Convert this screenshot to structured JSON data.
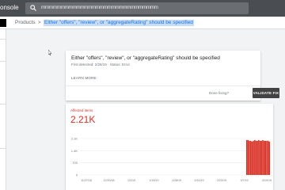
{
  "header": {
    "app_title": "onsole",
    "search": {
      "icon": "search-icon",
      "value": "Inspect any URL in \"m\"",
      "value_prefix": "",
      "value_masked": "mmmmmmmmmmmmmmmmmmmmmmmmmmmmmm"
    }
  },
  "breadcrumb": {
    "items": [
      {
        "label": "Products"
      },
      {
        "label": ">"
      },
      {
        "label": "Either \"offers\", \"review\", or \"aggregateRating\" should be specified"
      }
    ]
  },
  "issue": {
    "title": "Either \"offers\", \"review\", or \"aggregateRating\" should be specified",
    "meta": "First detected: 2/28/19  ·  Status: Error",
    "learn_more": "LEARN MORE",
    "done_fixing": "Done fixing?",
    "validate_button": "VALIDATE FIX"
  },
  "affected": {
    "label": "Affected items",
    "value": "2.21K"
  },
  "chart_data": {
    "type": "bar",
    "series": [
      {
        "color": "#d93025",
        "x": [
          "2/28/19",
          "3/1/19",
          "3/2/19",
          "3/3/19",
          "3/4/19",
          "3/5/19",
          "3/6/19",
          "3/7/19",
          "3/8/19",
          "3/9/19",
          "3/10/19",
          "3/11/19",
          "3/12/19",
          "3/13/19",
          "3/14/19",
          "3/15/19",
          "3/16/19",
          "3/17/19"
        ],
        "values": [
          2300,
          2300,
          2250,
          2250,
          2200,
          2250,
          2300,
          2250,
          2250,
          2300,
          2250,
          2250,
          2300,
          2250,
          2250,
          2250,
          2250,
          2200
        ]
      }
    ],
    "x_tick_labels": [
      "11/27/18",
      "12/20/18",
      "1/2/19",
      "1/15/19",
      "1/28/19",
      "2/10/19",
      "2/23/19",
      "3/7/19",
      "3/19/19"
    ],
    "y_tick_labels": [
      "2.1K",
      "1.4K",
      "700",
      "0"
    ],
    "ylim": [
      0,
      2400
    ],
    "grid": true
  }
}
